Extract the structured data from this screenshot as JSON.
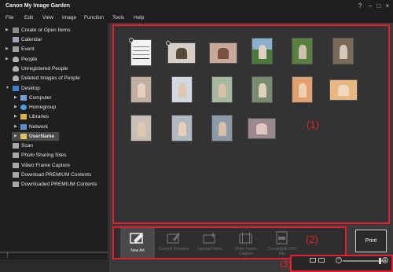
{
  "window": {
    "title": "Canon My Image Garden"
  },
  "menu": [
    "File",
    "Edit",
    "View",
    "Image",
    "Function",
    "Tools",
    "Help"
  ],
  "sidebar": {
    "items": [
      {
        "label": "Create or Open Items",
        "icon": "create-items-icon",
        "expandable": true
      },
      {
        "label": "Calendar",
        "icon": "calendar-icon",
        "expandable": false
      },
      {
        "label": "Event",
        "icon": "event-icon",
        "expandable": true
      },
      {
        "label": "People",
        "icon": "people-icon",
        "expandable": true
      },
      {
        "label": "Unregistered People",
        "icon": "person-icon",
        "expandable": false
      },
      {
        "label": "Deleted Images of People",
        "icon": "person-deleted-icon",
        "expandable": false
      },
      {
        "label": "Desktop",
        "icon": "desktop-icon",
        "expandable": true,
        "expanded": true
      },
      {
        "label": "Computer",
        "icon": "computer-icon",
        "expandable": true
      },
      {
        "label": "Homegroup",
        "icon": "homegroup-icon",
        "expandable": true
      },
      {
        "label": "Libraries",
        "icon": "libraries-icon",
        "expandable": true
      },
      {
        "label": "Network",
        "icon": "network-icon",
        "expandable": true
      },
      {
        "label": "UserName",
        "icon": "folder-icon",
        "expandable": true,
        "selected": true
      },
      {
        "label": "Scan",
        "icon": "scan-icon",
        "expandable": false
      },
      {
        "label": "Photo Sharing Sites",
        "icon": "photo-sharing-icon",
        "expandable": false
      },
      {
        "label": "Video Frame Capture",
        "icon": "video-frame-icon",
        "expandable": false
      },
      {
        "label": "Download PREMIUM Contents",
        "icon": "download-icon",
        "expandable": false
      },
      {
        "label": "Downloaded PREMIUM Contents",
        "icon": "downloaded-icon",
        "expandable": false
      }
    ]
  },
  "callouts": {
    "one": "(1)",
    "two": "(2)",
    "three": "(3)"
  },
  "toolbar": {
    "tools": [
      {
        "label": "New Art",
        "enabled": true
      },
      {
        "label": "Correct/ Enhance",
        "enabled": false
      },
      {
        "label": "Special Filters",
        "enabled": false
      },
      {
        "label": "Video Frame Capture",
        "enabled": false
      },
      {
        "label": "Create/Edit PDF File",
        "enabled": false
      }
    ],
    "print_label": "Print"
  },
  "zoom": {
    "minus": "−",
    "plus": "+",
    "level_fraction": 0.85
  },
  "colors": {
    "highlight": "#e51e2d",
    "selected_bg": "#4a4a4a"
  }
}
